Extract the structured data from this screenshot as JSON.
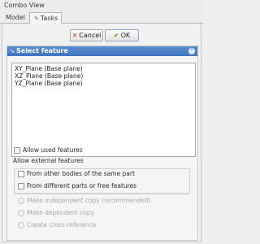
{
  "window": {
    "title": "Combo View"
  },
  "tabs": [
    {
      "label": "Model",
      "active": false
    },
    {
      "label": "Tasks",
      "active": true,
      "icon": "tasks-icon"
    }
  ],
  "buttons": {
    "cancel_label": "Cancel",
    "cancel_icon": "cancel-x-icon",
    "ok_label": "OK",
    "ok_icon": "checkmark-icon"
  },
  "task_panel": {
    "title": "Select feature",
    "features": [
      "XY_Plane (Base plane)",
      "XZ_Plane (Base plane)",
      "YZ_Plane (Base plane)"
    ],
    "allow_used_label": "Allow used features",
    "allow_used_checked": false,
    "external_heading": "Allow external features",
    "external_options": [
      {
        "label": "From other bodies of the same part",
        "checked": false
      },
      {
        "label": "From different parts or free features",
        "checked": false
      }
    ],
    "copy_options": [
      {
        "label": "Make independent copy (recommended)",
        "enabled": false
      },
      {
        "label": "Make dependent copy",
        "enabled": false
      },
      {
        "label": "Create cross-reference",
        "enabled": false
      }
    ]
  },
  "colors": {
    "header_blue": "#4a7fc8",
    "ok_check_green": "#4e9a23",
    "cancel_red": "#c0392b"
  }
}
